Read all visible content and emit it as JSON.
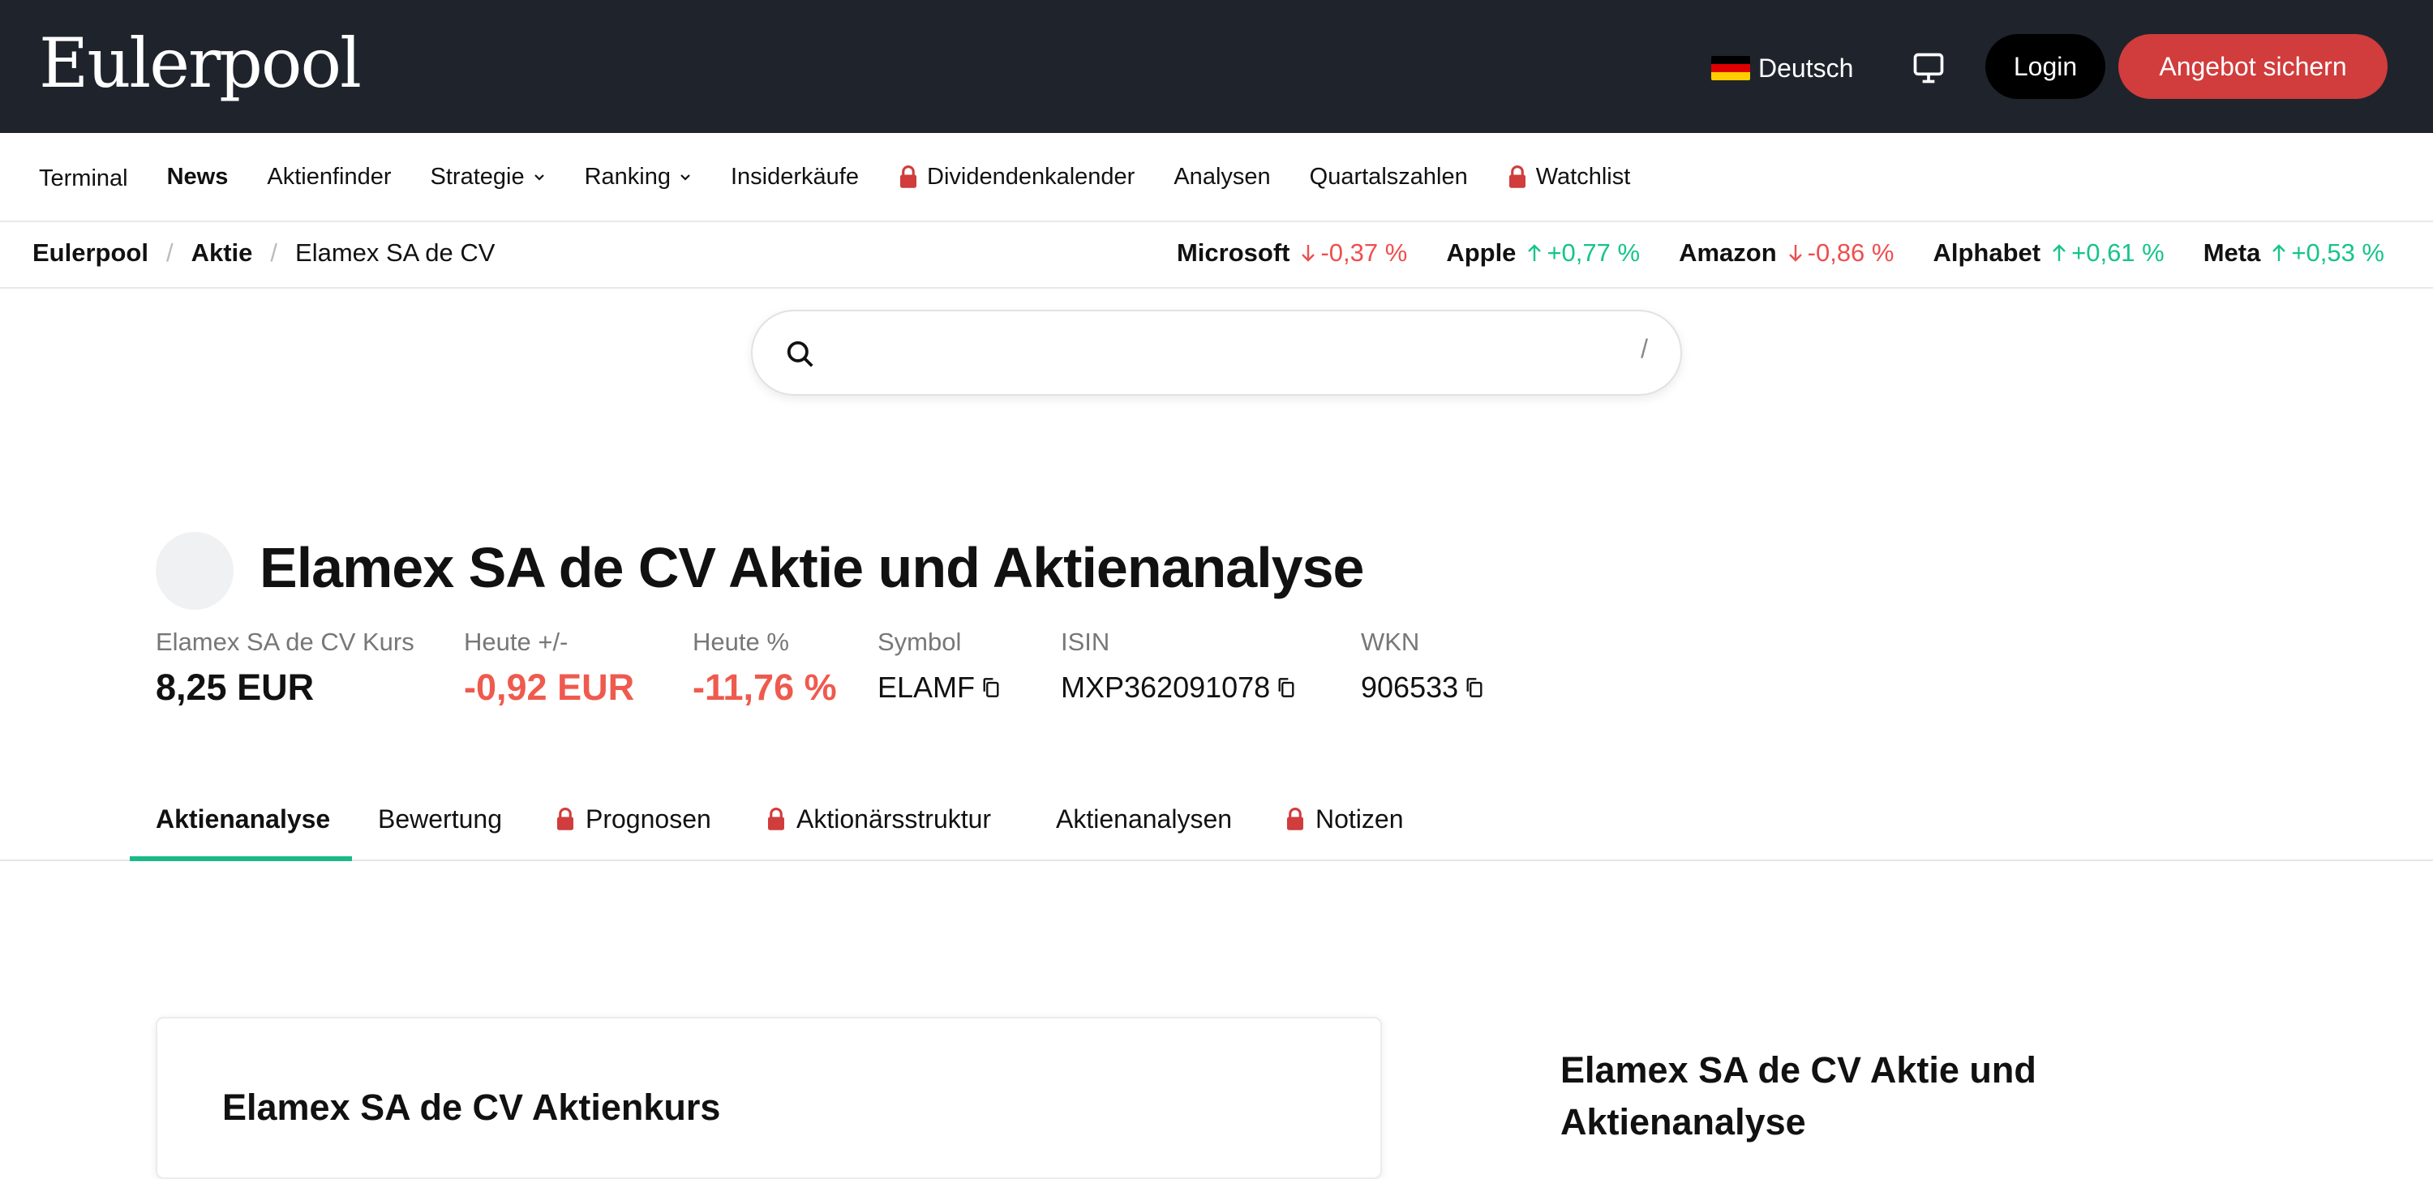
{
  "header": {
    "logo": "Eulerpool",
    "language": "Deutsch",
    "login_label": "Login",
    "offer_label": "Angebot sichern"
  },
  "nav": {
    "items": [
      {
        "label": "Terminal"
      },
      {
        "label": "News"
      },
      {
        "label": "Aktienfinder"
      },
      {
        "label": "Strategie"
      },
      {
        "label": "Ranking"
      },
      {
        "label": "Insiderkäufe"
      },
      {
        "label": "Dividendenkalender"
      },
      {
        "label": "Analysen"
      },
      {
        "label": "Quartalszahlen"
      },
      {
        "label": "Watchlist"
      }
    ]
  },
  "breadcrumb": {
    "items": [
      "Eulerpool",
      "Aktie",
      "Elamex SA de CV"
    ],
    "separator": "/"
  },
  "tickers": [
    {
      "name": "Microsoft",
      "change": "-0,37 %",
      "direction": "down"
    },
    {
      "name": "Apple",
      "change": "+0,77 %",
      "direction": "up"
    },
    {
      "name": "Amazon",
      "change": "-0,86 %",
      "direction": "down"
    },
    {
      "name": "Alphabet",
      "change": "+0,61 %",
      "direction": "up"
    },
    {
      "name": "Meta",
      "change": "+0,53 %",
      "direction": "up"
    }
  ],
  "search": {
    "placeholder": "",
    "shortcut": "/"
  },
  "stock": {
    "title": "Elamex SA de CV Aktie und Aktienanalyse",
    "price_label": "Elamex SA de CV Kurs",
    "price_value": "8,25 EUR",
    "change_label": "Heute +/-",
    "change_value": "-0,92 EUR",
    "pct_label": "Heute %",
    "pct_value": "-11,76 %",
    "symbol_label": "Symbol",
    "symbol_value": "ELAMF",
    "isin_label": "ISIN",
    "isin_value": "MXP362091078",
    "wkn_label": "WKN",
    "wkn_value": "906533"
  },
  "tabs": [
    {
      "label": "Aktienanalyse"
    },
    {
      "label": "Bewertung"
    },
    {
      "label": "Prognosen"
    },
    {
      "label": "Aktionärsstruktur"
    },
    {
      "label": "Aktienanalysen"
    },
    {
      "label": "Notizen"
    }
  ],
  "content": {
    "card_title": "Elamex SA de CV Aktienkurs",
    "side_title": "Elamex SA de CV Aktie und Aktienanalyse"
  },
  "colors": {
    "header_bg": "#1f242c",
    "accent_red": "#d13c3c",
    "negative": "#ef4e4e",
    "positive": "#17c489",
    "tab_underline": "#1bb98a"
  }
}
